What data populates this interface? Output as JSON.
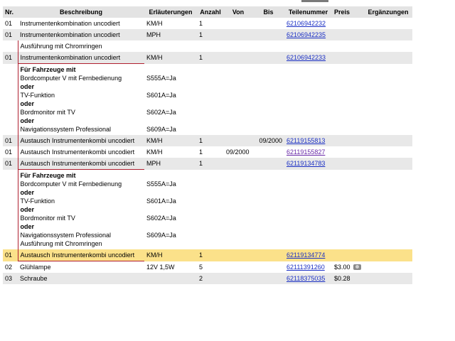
{
  "headers": {
    "nr": "Nr.",
    "beschreibung": "Beschreibung",
    "erlaeuterungen": "Erläuterungen",
    "anzahl": "Anzahl",
    "von": "Von",
    "bis": "Bis",
    "teilenummer": "Teilenummer",
    "preis": "Preis",
    "ergaenzungen": "Ergänzungen"
  },
  "rows": [
    {
      "nr": "01",
      "beschreibung": "Instrumentenkombination uncodiert",
      "erl": "KM/H",
      "anzahl": "1",
      "von": "",
      "bis": "",
      "teil": "62106942232",
      "preis": ""
    },
    {
      "nr": "01",
      "beschreibung": "Instrumentenkombination uncodiert",
      "erl": "MPH",
      "anzahl": "1",
      "von": "",
      "bis": "",
      "teil": "62106942235",
      "preis": ""
    },
    {
      "nr": "01",
      "beschreibung": "Instrumentenkombination uncodiert",
      "erl": "KM/H",
      "anzahl": "1",
      "von": "",
      "bis": "",
      "teil": "62106942233",
      "preis": ""
    },
    {
      "nr": "01",
      "beschreibung": "Austausch Instrumentenkombi uncodiert",
      "erl": "KM/H",
      "anzahl": "1",
      "von": "",
      "bis": "09/2000",
      "teil": "62119155813",
      "preis": ""
    },
    {
      "nr": "01",
      "beschreibung": "Austausch Instrumentenkombi uncodiert",
      "erl": "KM/H",
      "anzahl": "1",
      "von": "09/2000",
      "bis": "",
      "teil": "62119155827",
      "preis": ""
    },
    {
      "nr": "01",
      "beschreibung": "Austausch Instrumentenkombi uncodiert",
      "erl": "MPH",
      "anzahl": "1",
      "von": "",
      "bis": "",
      "teil": "62119134783",
      "preis": ""
    },
    {
      "nr": "01",
      "beschreibung": "Austausch Instrumentenkombi uncodiert",
      "erl": "KM/H",
      "anzahl": "1",
      "von": "",
      "bis": "",
      "teil": "62119134774",
      "preis": ""
    },
    {
      "nr": "02",
      "beschreibung": "Glühlampe",
      "erl": "12V 1,5W",
      "anzahl": "5",
      "von": "",
      "bis": "",
      "teil": "62111391260",
      "preis": "$3.00"
    },
    {
      "nr": "03",
      "beschreibung": "Schraube",
      "erl": "",
      "anzahl": "2",
      "von": "",
      "bis": "",
      "teil": "62118375035",
      "preis": "$0.28"
    }
  ],
  "note_chrome": "Ausführung mit Chromringen",
  "note1": {
    "heading": "Für Fahrzeuge mit",
    "items": [
      "Bordcomputer V mit Fernbedienung",
      "oder",
      "TV-Funktion",
      "oder",
      "Bordmonitor mit TV",
      "oder",
      "Navigationssystem Professional"
    ],
    "codes": [
      "S555A=Ja",
      "",
      "S601A=Ja",
      "",
      "S602A=Ja",
      "",
      "S609A=Ja"
    ]
  },
  "note2": {
    "heading": "Für Fahrzeuge mit",
    "items": [
      "Bordcomputer V mit Fernbedienung",
      "oder",
      "TV-Funktion",
      "oder",
      "Bordmonitor mit TV",
      "oder",
      "Navigationssystem Professional",
      "Ausführung mit Chromringen"
    ],
    "codes": [
      "S555A=Ja",
      "",
      "S601A=Ja",
      "",
      "S602A=Ja",
      "",
      "S609A=Ja",
      ""
    ]
  },
  "icons": {
    "photo": "camera-icon"
  },
  "colors": {
    "link": "#1a2fc4",
    "visited_link": "#6a2aa8",
    "highlight_row": "#fbe18a",
    "grey_row": "#e8e8e8",
    "header_bg": "#e3e3e3",
    "bracket": "#b02030"
  }
}
